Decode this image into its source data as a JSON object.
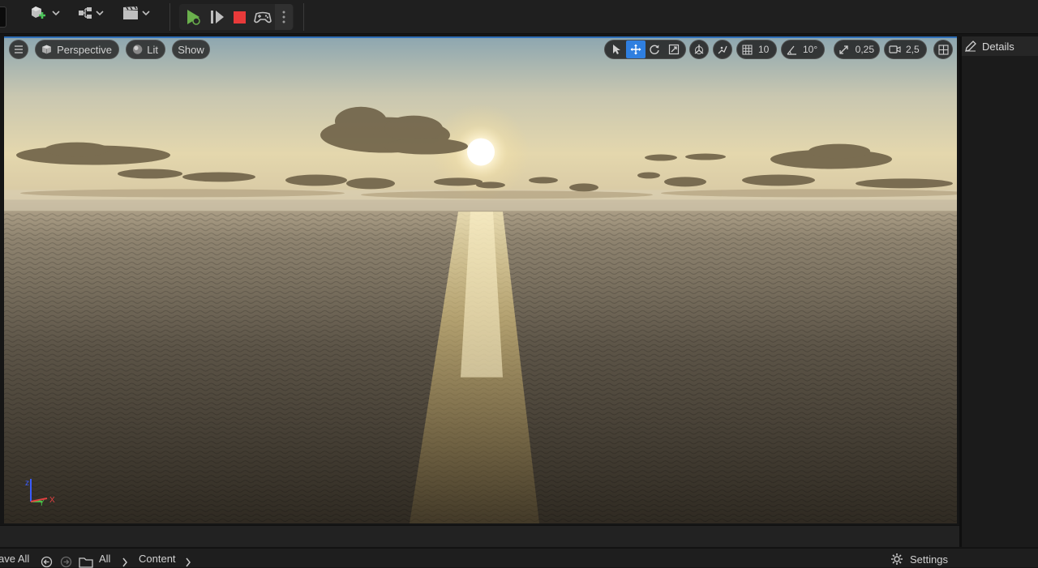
{
  "toolbar": {
    "buttons": [
      {
        "name": "add-content",
        "icon": "cube-plus-icon"
      },
      {
        "name": "blueprints",
        "icon": "blueprint-icon"
      },
      {
        "name": "cinematics",
        "icon": "clapperboard-icon"
      }
    ],
    "play_controls": [
      "play-icon",
      "advance-frame-icon",
      "stop-icon",
      "gamepad-icon",
      "more-vertical-icon"
    ],
    "colors": {
      "play": "#6ab04c",
      "stop": "#e83a3a"
    }
  },
  "viewport": {
    "menu_icon": "hamburger-icon",
    "perspective_label": "Perspective",
    "lit_label": "Lit",
    "show_label": "Show",
    "grid_snap": "10",
    "rotation_snap": "10°",
    "scale_snap": "0,25",
    "camera_speed": "2,5",
    "active_tool": "translate",
    "accent": "#2f7fe0"
  },
  "details": {
    "title": "Details"
  },
  "content_bar": {
    "save_all": "ave All",
    "breadcrumb": [
      "All",
      "Content"
    ],
    "settings_label": "Settings"
  }
}
